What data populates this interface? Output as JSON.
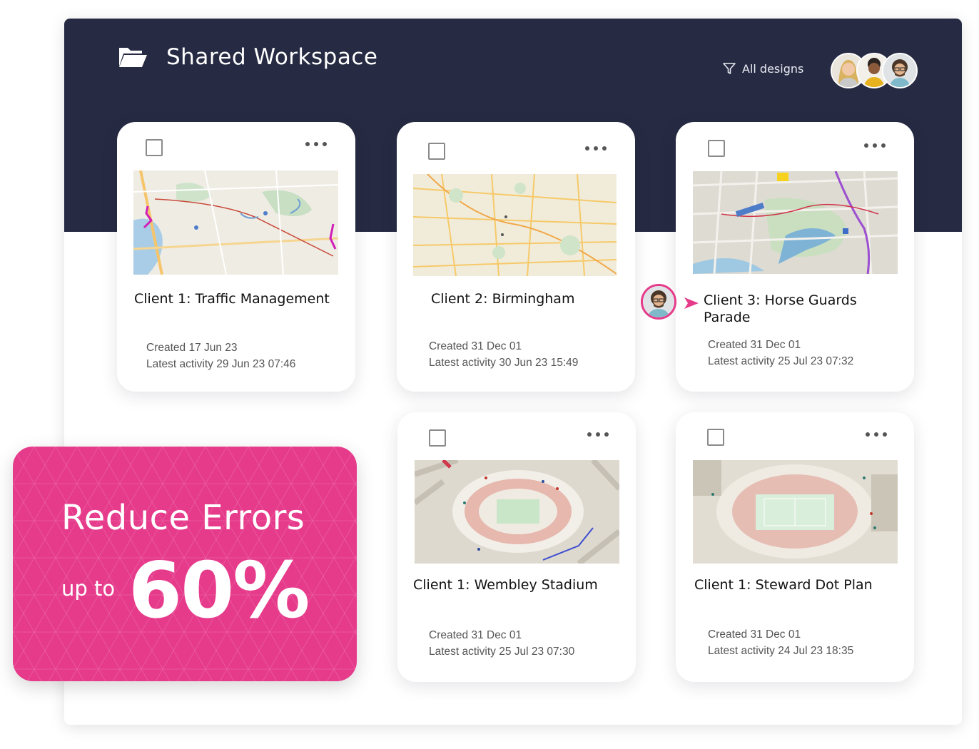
{
  "header": {
    "title": "Shared Workspace",
    "filter_label": "All designs",
    "folder_icon": "folder-open-icon",
    "filter_icon": "filter-icon"
  },
  "colors": {
    "header_bg": "#262a42",
    "accent": "#e63a8b",
    "card_bg": "#ffffff"
  },
  "cards": [
    {
      "title": "Client 1: Traffic Management",
      "created": "Created 17 Jun 23",
      "activity": "Latest activity 29 Jun 23 07:46"
    },
    {
      "title": "Client 2: Birmingham",
      "created": "Created 31 Dec 01",
      "activity": "Latest activity 30 Jun 23 15:49"
    },
    {
      "title": "Client 3: Horse Guards Parade",
      "created": "Created 31 Dec 01",
      "activity": "Latest activity 25 Jul 23 07:32"
    },
    {
      "title": "Client 1: Wembley Stadium",
      "created": "Created 31 Dec 01",
      "activity": "Latest activity 25 Jul 23 07:30"
    },
    {
      "title": "Client 1: Steward Dot Plan",
      "created": "Created 31 Dec 01",
      "activity": "Latest activity 24 Jul 23 18:35"
    }
  ],
  "promo": {
    "headline": "Reduce Errors",
    "prefix": "up to",
    "value": "60%"
  }
}
